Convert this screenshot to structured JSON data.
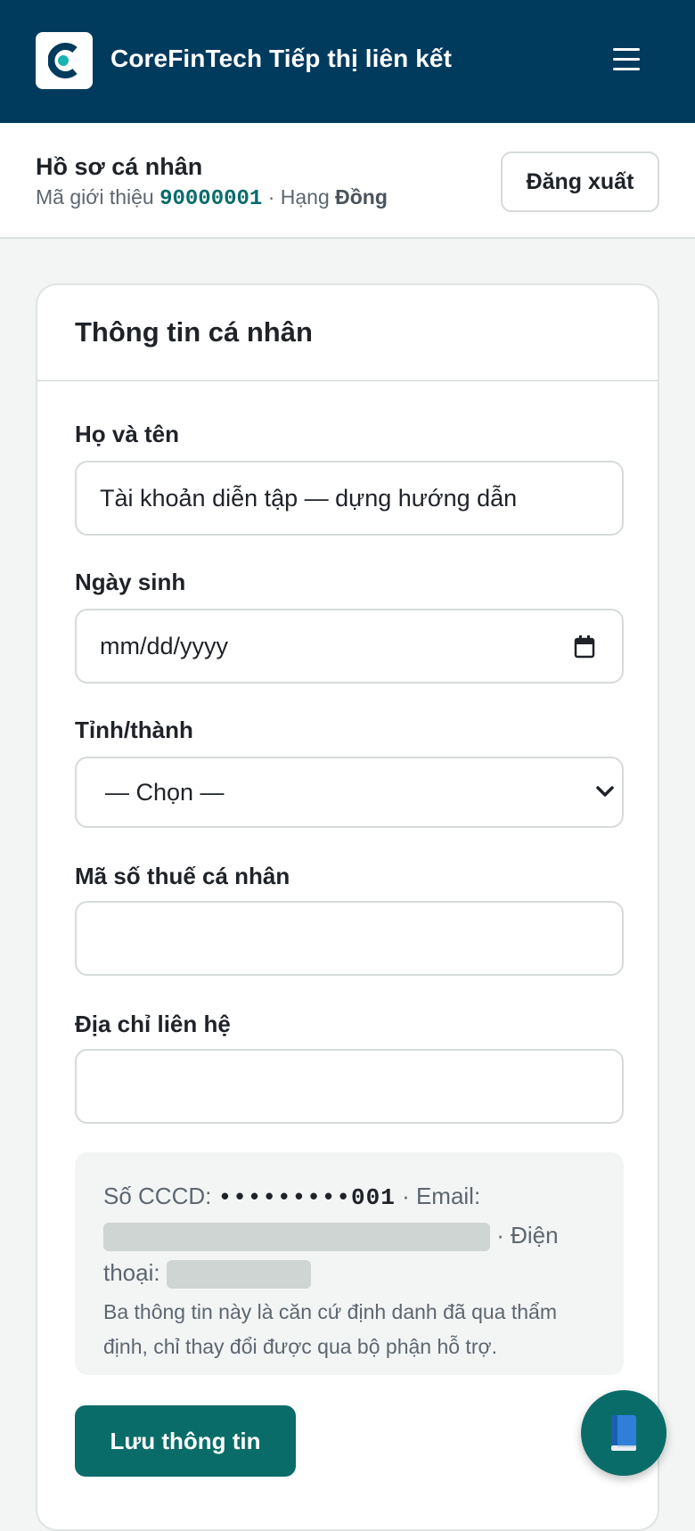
{
  "header": {
    "brand": "CoreFinTech Tiếp thị liên kết",
    "logo_letter": "C",
    "menu_icon": "hamburger-icon"
  },
  "profile": {
    "title": "Hồ sơ cá nhân",
    "referral_label": "Mã giới thiệu",
    "referral_code": "90000001",
    "separator": "·",
    "rank_label": "Hạng",
    "rank_value": "Đồng",
    "logout_label": "Đăng xuất"
  },
  "form": {
    "title": "Thông tin cá nhân",
    "fields": [
      {
        "label": "Họ và tên",
        "value": "Tài khoản diễn tập — dựng hướng dẫn"
      },
      {
        "label": "Ngày sinh",
        "placeholder": "mm/dd/yyyy"
      },
      {
        "label": "Tỉnh/thành",
        "selected": "— Chọn —"
      },
      {
        "label": "Mã số thuế cá nhân",
        "value": ""
      },
      {
        "label": "Địa chỉ liên hệ",
        "value": ""
      }
    ],
    "readonly": {
      "cccd_label": "Số CCCD:",
      "cccd_value": "•••••••••001",
      "email_label": "· Email:",
      "phone_label_1": "· Điện",
      "phone_label_2": "thoại:",
      "note": "Ba thông tin này là căn cứ định danh đã qua thẩm định, chỉ thay đổi được qua bộ phận hỗ trợ."
    },
    "save_label": "Lưu thông tin"
  },
  "fab": {
    "icon": "book-icon"
  },
  "colors": {
    "header_bg": "#003a5d",
    "accent": "#0a6c69",
    "code_color": "#0b6b6b"
  }
}
